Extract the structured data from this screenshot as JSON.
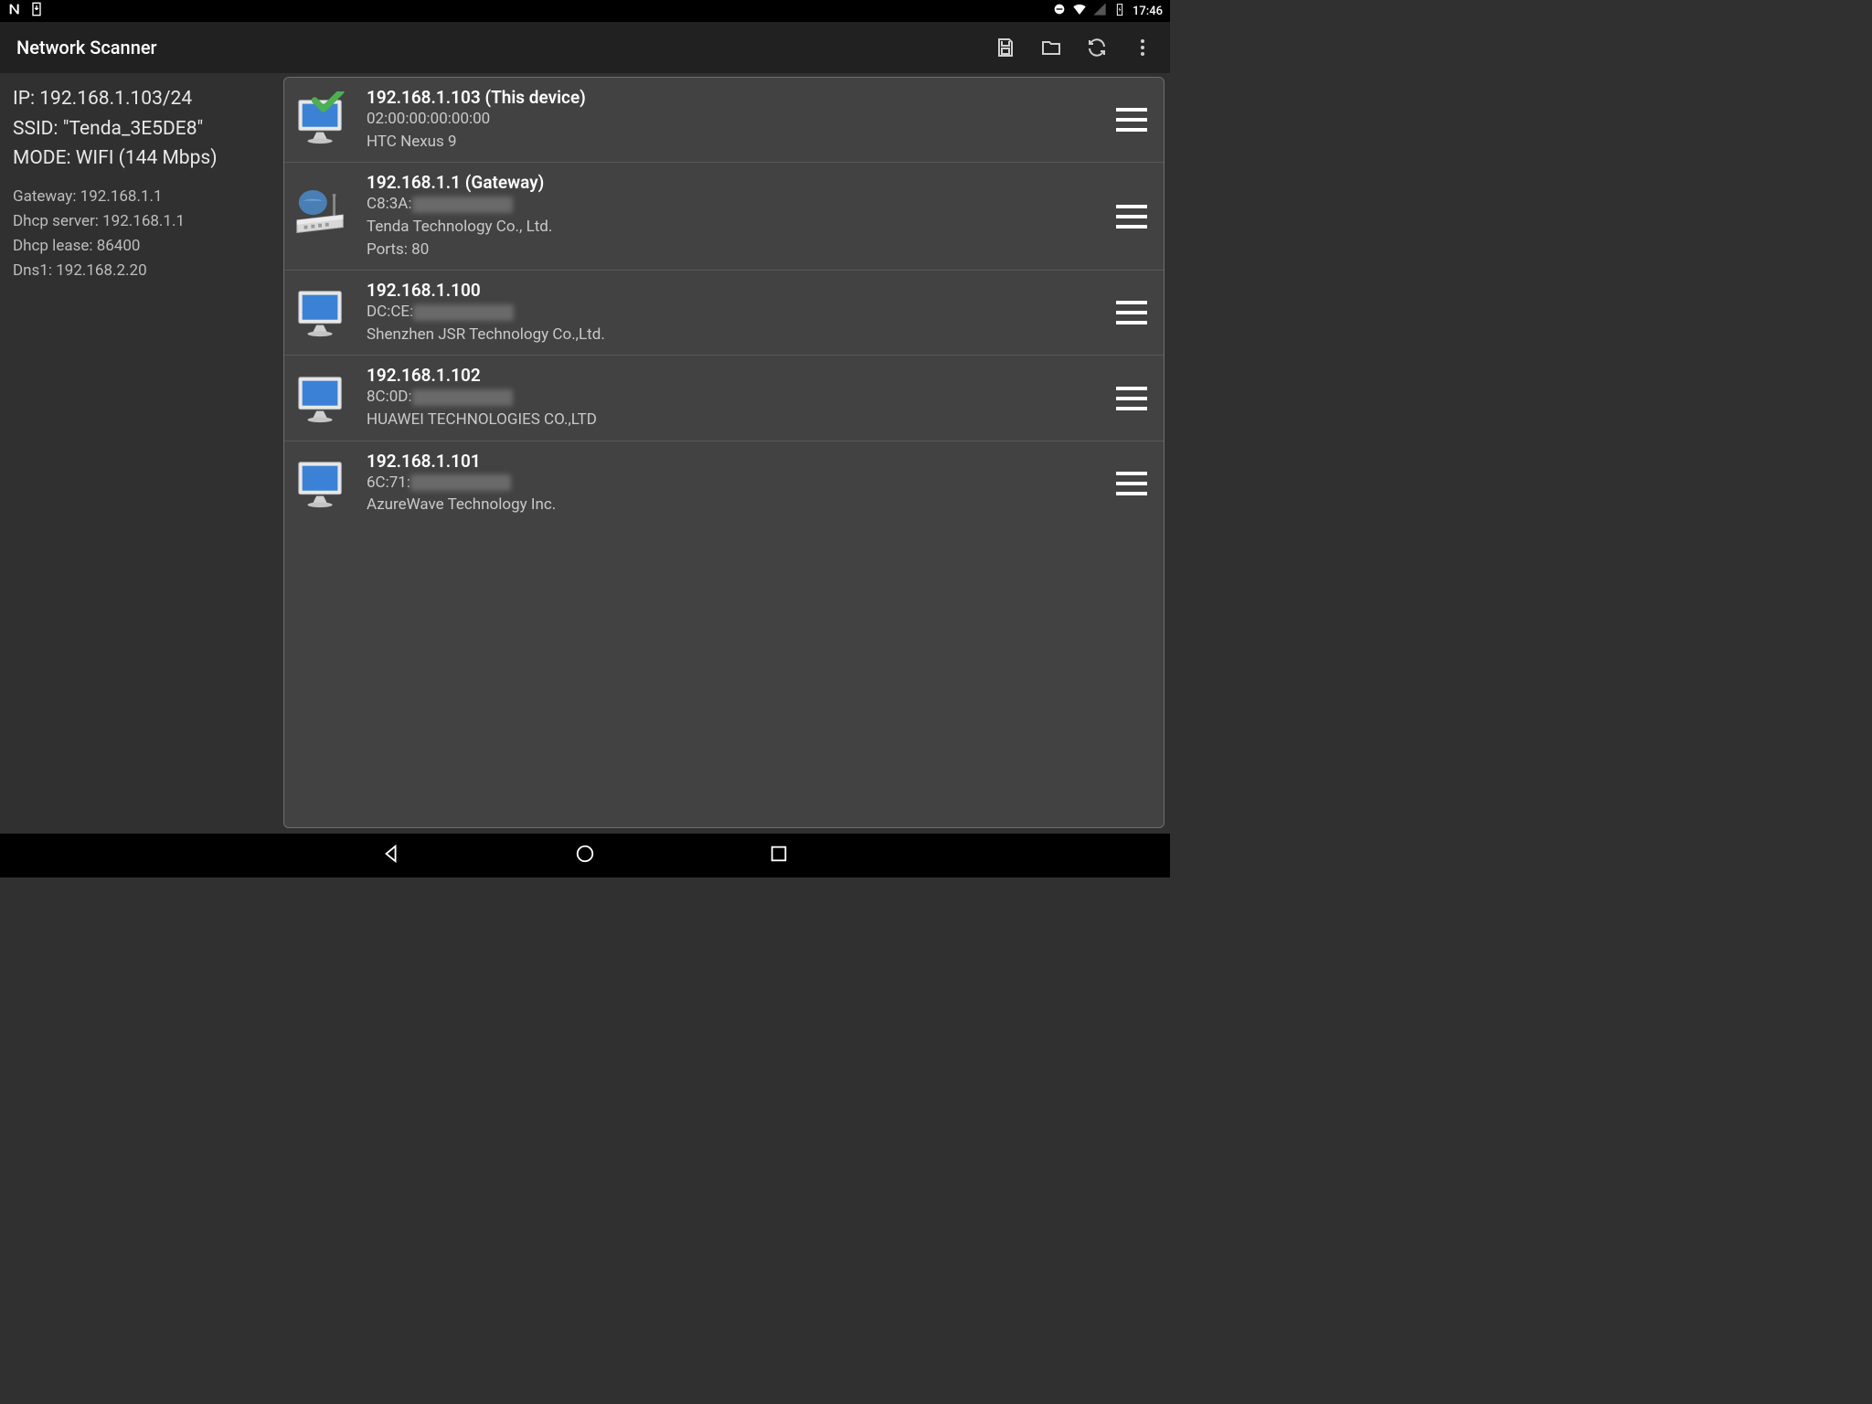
{
  "statusbar": {
    "time": "17:46"
  },
  "appbar": {
    "title": "Network Scanner"
  },
  "network": {
    "ip_line": "IP: 192.168.1.103/24",
    "ssid_line": "SSID: \"Tenda_3E5DE8\"",
    "mode_line": "MODE: WIFI (144 Mbps)",
    "gateway": "Gateway: 192.168.1.1",
    "dhcp_server": "Dhcp server: 192.168.1.1",
    "dhcp_lease": "Dhcp lease: 86400",
    "dns1": "Dns1: 192.168.2.20"
  },
  "devices": [
    {
      "icon": "monitor-check",
      "title": "192.168.1.103 (This device)",
      "mac_prefix": "02:00:00:00:00:00",
      "mac_blurred": false,
      "vendor": "HTC Nexus 9",
      "ports": ""
    },
    {
      "icon": "router",
      "title": "192.168.1.1 (Gateway)",
      "mac_prefix": "C8:3A:",
      "mac_blurred": true,
      "vendor": "Tenda Technology Co., Ltd.",
      "ports": "Ports: 80"
    },
    {
      "icon": "monitor",
      "title": "192.168.1.100",
      "mac_prefix": "DC:CE:",
      "mac_blurred": true,
      "vendor": "Shenzhen JSR Technology Co.,Ltd.",
      "ports": ""
    },
    {
      "icon": "monitor",
      "title": "192.168.1.102",
      "mac_prefix": "8C:0D:",
      "mac_blurred": true,
      "vendor": "HUAWEI TECHNOLOGIES CO.,LTD",
      "ports": ""
    },
    {
      "icon": "monitor",
      "title": "192.168.1.101",
      "mac_prefix": "6C:71:",
      "mac_blurred": true,
      "vendor": "AzureWave Technology Inc.",
      "ports": ""
    }
  ]
}
